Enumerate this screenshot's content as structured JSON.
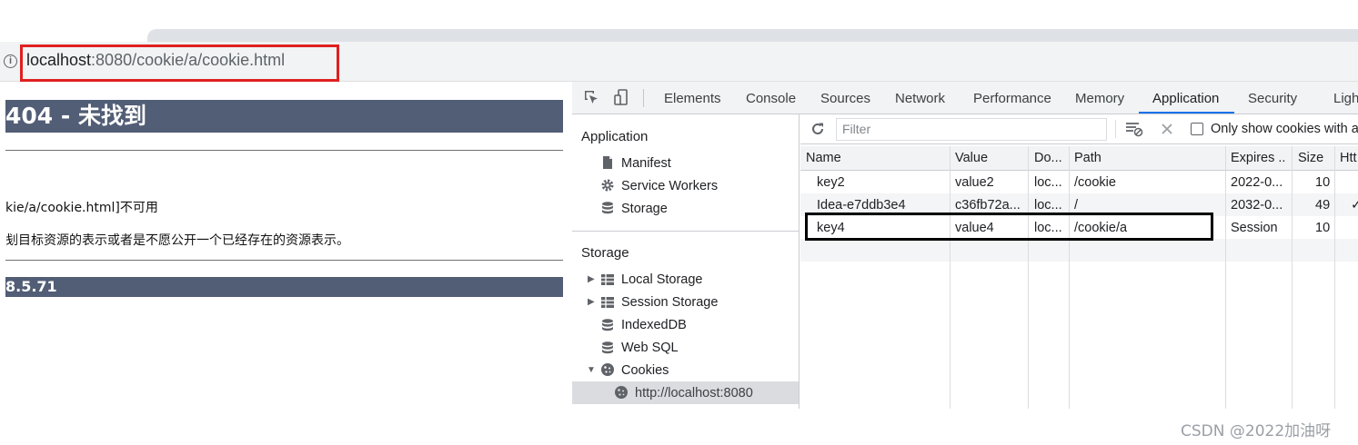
{
  "browser": {
    "url_host": "localhost",
    "url_rest": ":8080/cookie/a/cookie.html"
  },
  "page": {
    "heading": "404 - 未找到",
    "message_line": "kie/a/cookie.html]不可用",
    "description_line": "刬目标资源的表示或者是不愿公开一个已经存在的资源表示。",
    "footer_heading": "8.5.71"
  },
  "devtools": {
    "tabs": [
      "Elements",
      "Console",
      "Sources",
      "Network",
      "Performance",
      "Memory",
      "Application",
      "Security",
      "Ligh"
    ],
    "active_tab": "Application",
    "sidebar": {
      "application_title": "Application",
      "application_items": [
        "Manifest",
        "Service Workers",
        "Storage"
      ],
      "storage_title": "Storage",
      "storage_items": [
        "Local Storage",
        "Session Storage",
        "IndexedDB",
        "Web SQL",
        "Cookies"
      ],
      "cookie_origin": "http://localhost:8080"
    },
    "filter_placeholder": "Filter",
    "only_show_label": "Only show cookies with a",
    "columns": [
      "Name",
      "Value",
      "Do...",
      "Path",
      "Expires ..",
      "Size",
      "Htt"
    ],
    "rows": [
      {
        "name": "key2",
        "value": "value2",
        "domain": "loc...",
        "path": "/cookie",
        "expires": "2022-0...",
        "size": "10",
        "http": ""
      },
      {
        "name": "Idea-e7ddb3e4",
        "value": "c36fb72a...",
        "domain": "loc...",
        "path": "/",
        "expires": "2032-0...",
        "size": "49",
        "http": "✓"
      },
      {
        "name": "key4",
        "value": "value4",
        "domain": "loc...",
        "path": "/cookie/a",
        "expires": "Session",
        "size": "10",
        "http": ""
      }
    ]
  },
  "watermark": "CSDN @2022加油呀",
  "icons": [
    "info-icon",
    "inspect-icon",
    "device-toggle-icon",
    "file-icon",
    "gear-icon",
    "database-icon",
    "table-icon",
    "cookie-icon",
    "refresh-icon",
    "clear-filter-icon",
    "close-icon"
  ],
  "colors": {
    "header_bg": "#525d76",
    "url_highlight": "#e02020",
    "active_tab": "#1a73e8"
  }
}
